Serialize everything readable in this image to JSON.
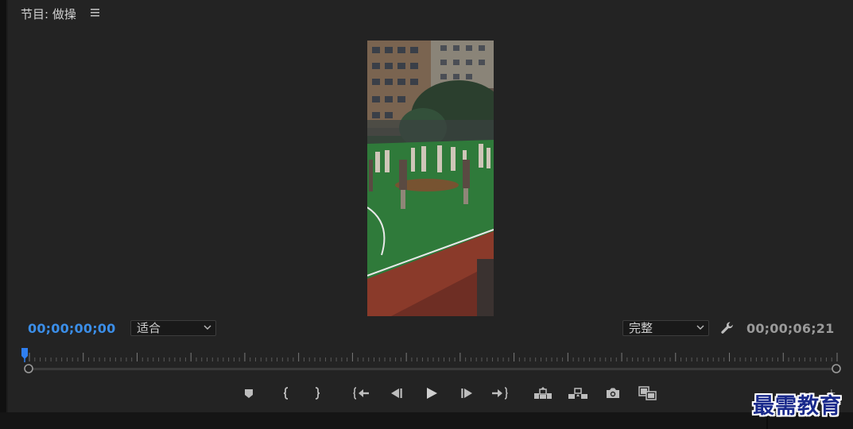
{
  "panel": {
    "title": "节目: 做操",
    "menu_icon": "hamburger-menu-icon"
  },
  "preview": {
    "content": "video-frame",
    "colors": {
      "court": "#2f7a3a",
      "track": "#8a3a2a",
      "building": "#6b5a4a",
      "trees": "#2e4a2e"
    }
  },
  "timecode": {
    "current": "00;00;00;00",
    "duration": "00;00;06;21",
    "current_color": "#3b8ee8"
  },
  "zoom_select": {
    "value": "适合"
  },
  "resolution_select": {
    "value": "完整"
  },
  "transport": {
    "buttons": [
      {
        "name": "add-marker-button",
        "icon": "marker-icon"
      },
      {
        "name": "mark-in-button",
        "icon": "mark-in-icon"
      },
      {
        "name": "mark-out-button",
        "icon": "mark-out-icon"
      },
      {
        "name": "go-to-in-button",
        "icon": "go-to-in-icon"
      },
      {
        "name": "step-back-button",
        "icon": "step-back-icon"
      },
      {
        "name": "play-button",
        "icon": "play-icon"
      },
      {
        "name": "step-forward-button",
        "icon": "step-forward-icon"
      },
      {
        "name": "go-to-out-button",
        "icon": "go-to-out-icon"
      },
      {
        "name": "lift-button",
        "icon": "lift-icon"
      },
      {
        "name": "extract-button",
        "icon": "extract-icon"
      },
      {
        "name": "export-frame-button",
        "icon": "camera-icon"
      },
      {
        "name": "comparison-view-button",
        "icon": "comparison-view-icon"
      }
    ]
  },
  "watermark": {
    "text": "最需教育"
  }
}
